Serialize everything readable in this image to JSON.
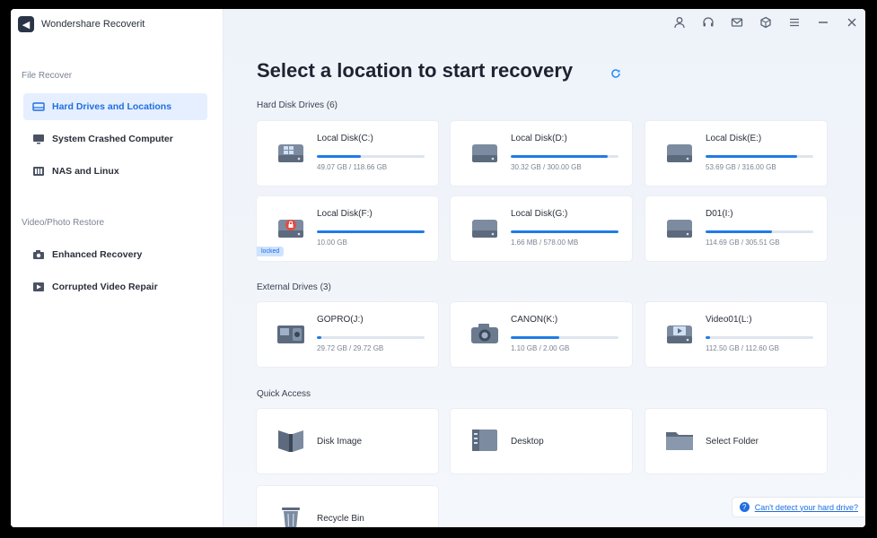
{
  "app": {
    "title": "Wondershare Recoverit",
    "logo_glyph": "◀"
  },
  "sidebar": {
    "file_recover_label": "File Recover",
    "video_photo_label": "Video/Photo Restore",
    "items": [
      {
        "label": "Hard Drives and Locations",
        "icon": "hard-drive-icon",
        "active": true
      },
      {
        "label": "System Crashed Computer",
        "icon": "monitor-icon",
        "active": false
      },
      {
        "label": "NAS and Linux",
        "icon": "nas-icon",
        "active": false
      },
      {
        "label": "Enhanced Recovery",
        "icon": "camera-icon",
        "active": false
      },
      {
        "label": "Corrupted Video Repair",
        "icon": "video-repair-icon",
        "active": false
      }
    ]
  },
  "main": {
    "title": "Select a location to start recovery",
    "hard_disk_label": "Hard Disk Drives (6)",
    "external_label": "External Drives (3)",
    "quick_access_label": "Quick Access",
    "hard_disks": [
      {
        "name": "Local Disk(C:)",
        "size": "49.07 GB / 118.66 GB",
        "usage": 0.41,
        "type": "windows"
      },
      {
        "name": "Local Disk(D:)",
        "size": "30.32 GB / 300.00 GB",
        "usage": 0.9,
        "type": "disk"
      },
      {
        "name": "Local Disk(E:)",
        "size": "53.69 GB / 316.00 GB",
        "usage": 0.85,
        "type": "disk"
      },
      {
        "name": "Local Disk(F:)",
        "size": "10.00 GB",
        "usage": 1.0,
        "type": "locked",
        "tag": "locked"
      },
      {
        "name": "Local Disk(G:)",
        "size": "1.66 MB / 578.00 MB",
        "usage": 1.0,
        "type": "disk"
      },
      {
        "name": "D01(I:)",
        "size": "114.69 GB / 305.51 GB",
        "usage": 0.62,
        "type": "disk"
      }
    ],
    "external_drives": [
      {
        "name": "GOPRO(J:)",
        "size": "29.72 GB / 29.72 GB",
        "usage": 0.04,
        "type": "gopro"
      },
      {
        "name": "CANON(K:)",
        "size": "1.10 GB / 2.00 GB",
        "usage": 0.45,
        "type": "camera"
      },
      {
        "name": "Video01(L:)",
        "size": "112.50 GB / 112.60 GB",
        "usage": 0.04,
        "type": "video"
      }
    ],
    "quick_access": [
      {
        "name": "Disk Image",
        "icon": "disk-image-icon"
      },
      {
        "name": "Desktop",
        "icon": "desktop-icon"
      },
      {
        "name": "Select Folder",
        "icon": "folder-icon"
      },
      {
        "name": "Recycle Bin",
        "icon": "recycle-bin-icon"
      }
    ],
    "help_link": "Can't detect your hard drive?"
  },
  "colors": {
    "accent": "#1f7be6",
    "active_bg": "#e5efff",
    "sidebar_bg": "#ffffff",
    "main_bg": "#eef3fa"
  }
}
